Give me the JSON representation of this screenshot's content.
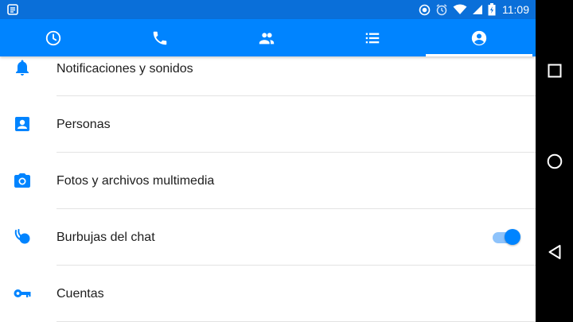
{
  "status_bar": {
    "time": "11:09",
    "icons": [
      "notification-icon",
      "data-saver-icon",
      "alarm-icon",
      "wifi-icon",
      "signal-icon",
      "battery-charging-icon"
    ]
  },
  "tabs": [
    {
      "name": "recent",
      "icon": "clock-icon",
      "selected": false
    },
    {
      "name": "calls",
      "icon": "phone-icon",
      "selected": false
    },
    {
      "name": "people",
      "icon": "people-icon",
      "selected": false
    },
    {
      "name": "list",
      "icon": "list-icon",
      "selected": false
    },
    {
      "name": "profile",
      "icon": "account-circle-icon",
      "selected": true
    }
  ],
  "settings": {
    "items": [
      {
        "label": "Notificaciones y sonidos",
        "icon": "bell-icon"
      },
      {
        "label": "Personas",
        "icon": "contact-icon"
      },
      {
        "label": "Fotos y archivos multimedia",
        "icon": "camera-icon"
      },
      {
        "label": "Burbujas del chat",
        "icon": "chat-bubbles-icon",
        "toggle": true
      },
      {
        "label": "Cuentas",
        "icon": "key-icon"
      }
    ]
  },
  "nav_bar": {
    "buttons": [
      "recents-square-icon",
      "home-circle-icon",
      "back-triangle-icon"
    ]
  },
  "colors": {
    "status_bar": "#0a6fd9",
    "tab_bar": "#0084ff",
    "accent": "#0084ff",
    "toggle_track": "#8ec3fb",
    "text": "#1d1d1d",
    "divider": "#e3e3e3"
  }
}
